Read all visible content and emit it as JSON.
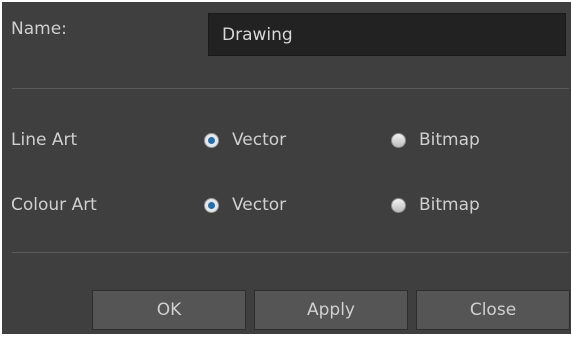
{
  "name": {
    "label": "Name:",
    "value": "Drawing"
  },
  "line_art": {
    "label": "Line Art",
    "option_vector": "Vector",
    "option_bitmap": "Bitmap",
    "selected": "Vector"
  },
  "colour_art": {
    "label": "Colour Art",
    "option_vector": "Vector",
    "option_bitmap": "Bitmap",
    "selected": "Vector"
  },
  "buttons": {
    "ok": "OK",
    "apply": "Apply",
    "close": "Close"
  },
  "colors": {
    "background": "#3f3f3f",
    "input_background": "#222222",
    "button_background": "#555555",
    "radio_selected": "#1f6fb4"
  }
}
